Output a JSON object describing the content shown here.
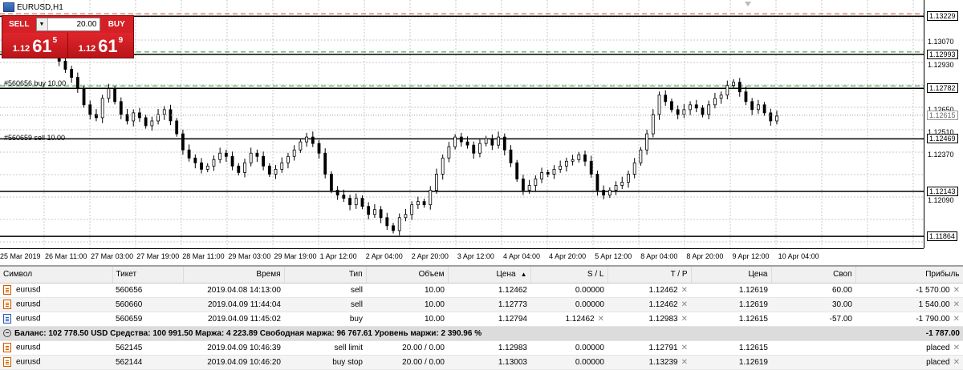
{
  "chart": {
    "title": "EURUSD,H1",
    "price_scale": [
      "1.13070",
      "1.12930",
      "1.12650",
      "1.12510",
      "1.12370",
      "1.12090"
    ],
    "price_boxes": [
      {
        "value": "1.13229",
        "price": 1.13229
      },
      {
        "value": "1.12993",
        "price": 1.12993
      },
      {
        "value": "1.12782",
        "price": 1.12782
      },
      {
        "value": "1.12469",
        "price": 1.12469
      },
      {
        "value": "1.12143",
        "price": 1.12143
      },
      {
        "value": "1.11864",
        "price": 1.11864
      }
    ],
    "current_price": {
      "value": "1.12615",
      "price": 1.12615
    },
    "time_labels": [
      "25 Mar 2019",
      "26 Mar 11:00",
      "27 Mar 03:00",
      "27 Mar 19:00",
      "28 Mar 11:00",
      "29 Mar 03:00",
      "29 Mar 19:00",
      "1 Apr 12:00",
      "2 Apr 04:00",
      "2 Apr 20:00",
      "3 Apr 12:00",
      "4 Apr 04:00",
      "4 Apr 20:00",
      "5 Apr 12:00",
      "8 Apr 04:00",
      "8 Apr 20:00",
      "9 Apr 12:00",
      "10 Apr 04:00"
    ],
    "order_labels": [
      {
        "text": "#560656 buy 10.00"
      },
      {
        "text": "#560659 sell 10.00"
      }
    ],
    "closes": [
      1.1302,
      1.1295,
      1.129,
      1.1285,
      1.1278,
      1.1268,
      1.1262,
      1.126,
      1.1272,
      1.1278,
      1.127,
      1.1262,
      1.1258,
      1.1263,
      1.126,
      1.1255,
      1.1258,
      1.1262,
      1.1265,
      1.1258,
      1.125,
      1.124,
      1.1235,
      1.1232,
      1.1228,
      1.123,
      1.1234,
      1.1238,
      1.1236,
      1.123,
      1.1226,
      1.1232,
      1.1238,
      1.1236,
      1.123,
      1.1225,
      1.1228,
      1.1232,
      1.1236,
      1.124,
      1.1245,
      1.1248,
      1.1244,
      1.1238,
      1.1225,
      1.1215,
      1.1212,
      1.121,
      1.1206,
      1.121,
      1.1205,
      1.12,
      1.1203,
      1.1198,
      1.1193,
      1.119,
      1.1198,
      1.12,
      1.1206,
      1.1208,
      1.1206,
      1.1215,
      1.1225,
      1.1235,
      1.1242,
      1.1248,
      1.1245,
      1.1243,
      1.1238,
      1.1244,
      1.1247,
      1.1243,
      1.1248,
      1.124,
      1.1232,
      1.1222,
      1.1215,
      1.1218,
      1.1222,
      1.1226,
      1.1225,
      1.1228,
      1.123,
      1.1233,
      1.1234,
      1.1237,
      1.1233,
      1.1225,
      1.1215,
      1.1212,
      1.1215,
      1.1218,
      1.122,
      1.1225,
      1.1232,
      1.124,
      1.125,
      1.1262,
      1.1274,
      1.127,
      1.1265,
      1.1262,
      1.1265,
      1.1268,
      1.1266,
      1.1262,
      1.1268,
      1.1272,
      1.1274,
      1.128,
      1.1282,
      1.1276,
      1.127,
      1.1265,
      1.1268,
      1.1263,
      1.1258,
      1.1261
    ]
  },
  "trade_panel": {
    "sell_label": "SELL",
    "buy_label": "BUY",
    "lot": "20.00",
    "sell_small": "1.12",
    "sell_big": "61",
    "sell_sup": "5",
    "buy_small": "1.12",
    "buy_big": "61",
    "buy_sup": "9"
  },
  "table": {
    "headers": {
      "symbol": "Символ",
      "ticket": "Тикет",
      "time": "Время",
      "type": "Тип",
      "volume": "Объем",
      "price": "Цена",
      "sl": "S / L",
      "tp": "T / P",
      "cur_price": "Цена",
      "swap": "Своп",
      "profit": "Прибыль"
    },
    "positions": [
      {
        "symbol": "eurusd",
        "ticket": "560656",
        "time": "2019.04.08 14:13:00",
        "type": "sell",
        "volume": "10.00",
        "price": "1.12462",
        "sl": "0.00000",
        "tp": "1.12462",
        "cur_price": "1.12619",
        "swap": "60.00",
        "profit": "-1 570.00",
        "icon": "orange"
      },
      {
        "symbol": "eurusd",
        "ticket": "560660",
        "time": "2019.04.09 11:44:04",
        "type": "sell",
        "volume": "10.00",
        "price": "1.12773",
        "sl": "0.00000",
        "tp": "1.12462",
        "cur_price": "1.12619",
        "swap": "30.00",
        "profit": "1 540.00",
        "icon": "orange"
      },
      {
        "symbol": "eurusd",
        "ticket": "560659",
        "time": "2019.04.09 11:45:02",
        "type": "buy",
        "volume": "10.00",
        "price": "1.12794",
        "sl": "1.12462",
        "tp": "1.12983",
        "cur_price": "1.12615",
        "swap": "-57.00",
        "profit": "-1 790.00",
        "icon": "blue"
      }
    ],
    "balance_text": "Баланс: 102 778.50 USD  Средства: 100 991.50  Маржа: 4 223.89  Свободная маржа: 96 767.61  Уровень маржи: 2 390.96 %",
    "balance_profit": "-1 787.00",
    "orders": [
      {
        "symbol": "eurusd",
        "ticket": "562145",
        "time": "2019.04.09 10:46:39",
        "type": "sell limit",
        "volume": "20.00 / 0.00",
        "price": "1.12983",
        "sl": "0.00000",
        "tp": "1.12791",
        "cur_price": "1.12615",
        "swap": "",
        "profit": "placed",
        "icon": "orange"
      },
      {
        "symbol": "eurusd",
        "ticket": "562144",
        "time": "2019.04.09 10:46:20",
        "type": "buy stop",
        "volume": "20.00 / 0.00",
        "price": "1.13003",
        "sl": "0.00000",
        "tp": "1.13239",
        "cur_price": "1.12619",
        "swap": "",
        "profit": "placed",
        "icon": "orange"
      }
    ]
  }
}
